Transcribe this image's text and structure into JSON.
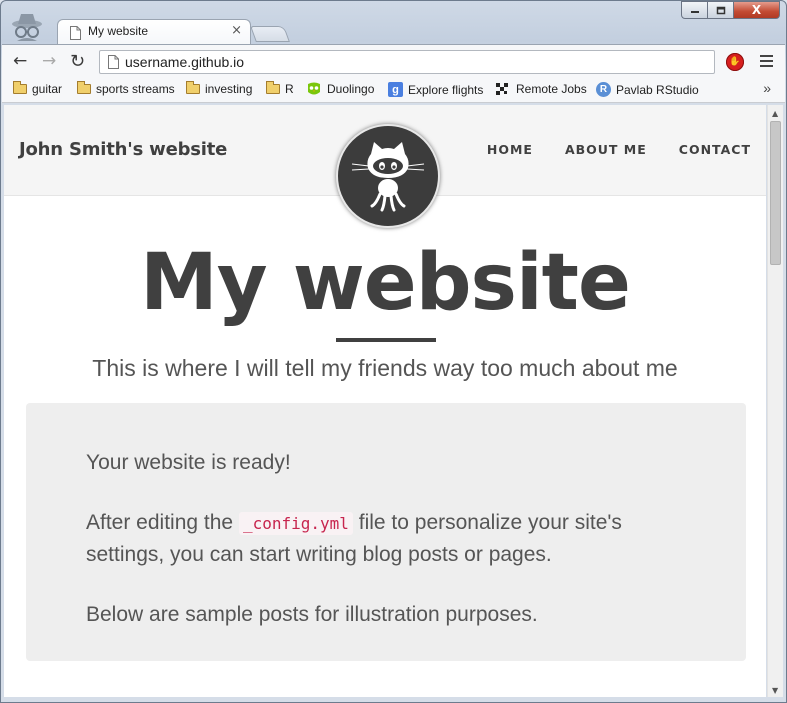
{
  "browser": {
    "tab_title": "My website",
    "tab_close": "×",
    "url": "username.github.io",
    "window_controls": {
      "minimize": "",
      "maximize": "",
      "close": "X"
    },
    "nav": {
      "back": "←",
      "forward": "→",
      "reload": "↻"
    },
    "bookmarks": [
      {
        "label": "guitar",
        "icon": "folder-icon"
      },
      {
        "label": "sports streams",
        "icon": "folder-icon"
      },
      {
        "label": "investing",
        "icon": "folder-icon"
      },
      {
        "label": "R",
        "icon": "folder-icon"
      },
      {
        "label": "Duolingo",
        "icon": "duolingo-owl-icon"
      },
      {
        "label": "Explore flights",
        "icon": "google-g-icon"
      },
      {
        "label": "Remote Jobs",
        "icon": "remote-jobs-icon"
      },
      {
        "label": "Pavlab RStudio",
        "icon": "rstudio-icon"
      }
    ],
    "bookmarks_more": "»"
  },
  "site": {
    "brand": "John Smith's website",
    "nav_links": [
      "HOME",
      "ABOUT ME",
      "CONTACT"
    ],
    "title": "My website",
    "subtitle": "This is where I will tell my friends way too much about me",
    "box": {
      "line1": "Your website is ready!",
      "line2_before": "After editing the",
      "line2_code": "_config.yml",
      "line2_after": "file to personalize your site's settings, you can start writing blog posts or pages.",
      "line3": "Below are sample posts for illustration purposes."
    }
  },
  "colors": {
    "text": "#404040",
    "nav_bg": "#f5f5f5",
    "box_bg": "#eeeeee",
    "code": "#c7254e"
  }
}
